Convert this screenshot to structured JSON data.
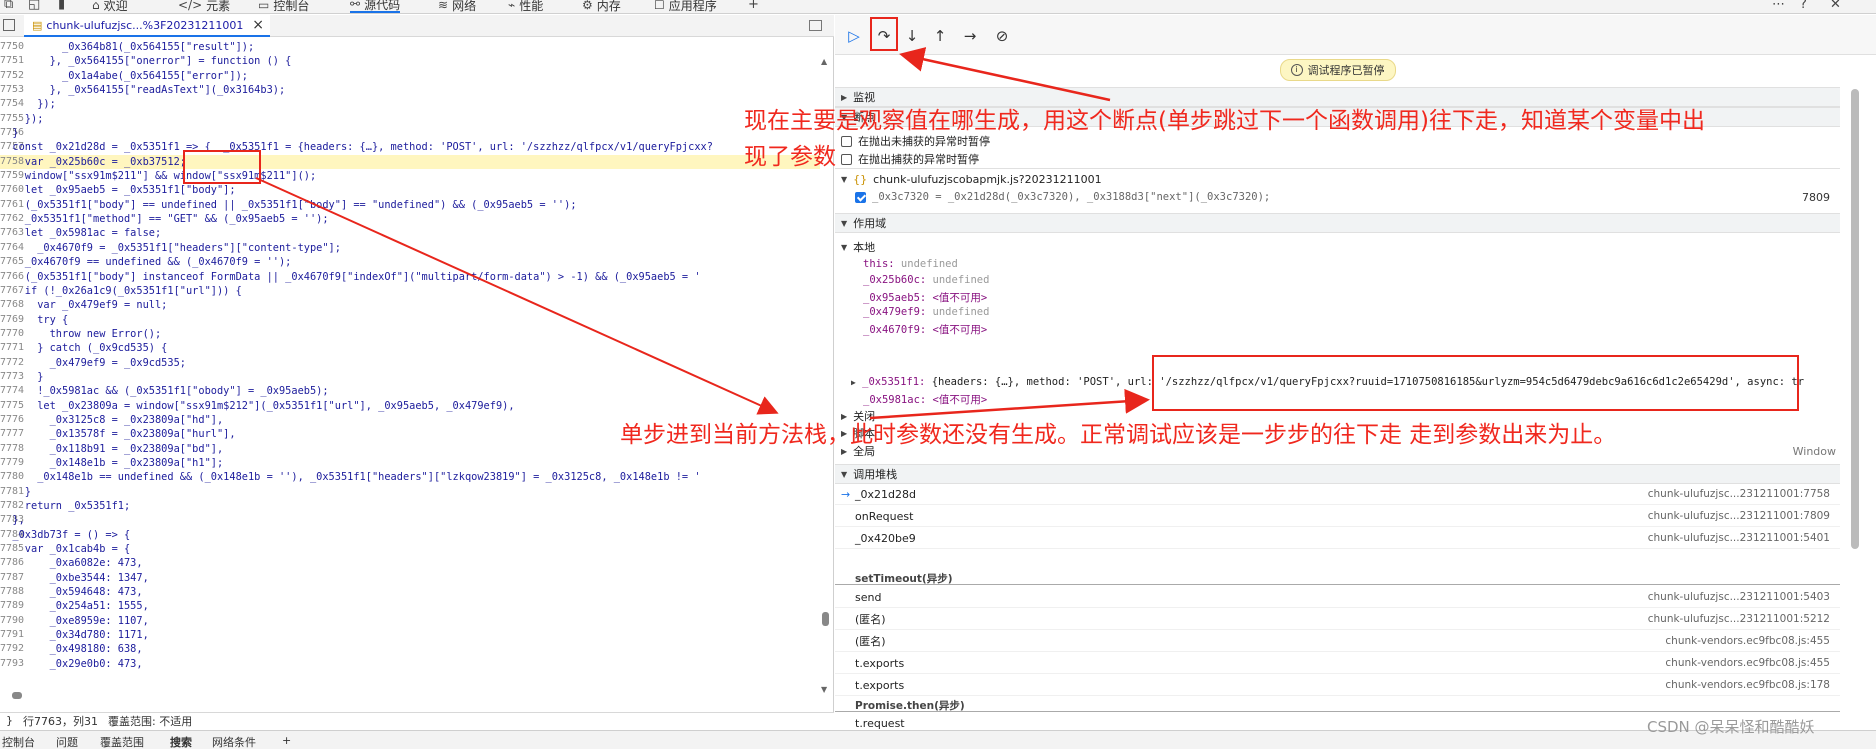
{
  "top_tabs": [
    {
      "label": "欢迎"
    },
    {
      "label": "元素"
    },
    {
      "label": "控制台"
    },
    {
      "label": "源代码"
    },
    {
      "label": "网络"
    },
    {
      "label": "性能"
    },
    {
      "label": "内存"
    },
    {
      "label": "应用程序"
    }
  ],
  "file_tab": {
    "label": "chunk-ulufuzjsc...%3F20231211001",
    "close": "×"
  },
  "code_lines": [
    {
      "n": "7750",
      "code": "          _0x364b81(_0x564155[\"result\"]);",
      "hl": false
    },
    {
      "n": "7751",
      "code": "        }, _0x564155[\"onerror\"] = function () {",
      "hl": false
    },
    {
      "n": "7752",
      "code": "          _0x1a4abe(_0x564155[\"error\"]);",
      "hl": false
    },
    {
      "n": "7753",
      "code": "        }, _0x564155[\"readAsText\"](_0x3164b3);",
      "hl": false
    },
    {
      "n": "7754",
      "code": "      });",
      "hl": false
    },
    {
      "n": "7755",
      "code": "    });",
      "hl": false
    },
    {
      "n": "7756",
      "code": "  }",
      "hl": false
    },
    {
      "n": "7757",
      "code": "  const _0x21d28d = _0x5351f1 => {  _0x5351f1 = {headers: {…}, method: 'POST', url: '/szzhzz/qlfpcx/v1/queryFpjcxx?",
      "hl": false
    },
    {
      "n": "7758",
      "code": "    var _0x25b60c = _0xb37512;",
      "hl": true
    },
    {
      "n": "7759",
      "code": "    window[\"ssx91m$211\"] && window[\"ssx91m$211\"]();",
      "hl": false
    },
    {
      "n": "7760",
      "code": "    let _0x95aeb5 = _0x5351f1[\"body\"];",
      "hl": false
    },
    {
      "n": "7761",
      "code": "    (_0x5351f1[\"body\"] == undefined || _0x5351f1[\"body\"] == \"undefined\") && (_0x95aeb5 = '');",
      "hl": false
    },
    {
      "n": "7762",
      "code": "    _0x5351f1[\"method\"] == \"GET\" && (_0x95aeb5 = '');",
      "hl": false
    },
    {
      "n": "7763",
      "code": "    let _0x5981ac = false;",
      "hl": false
    },
    {
      "n": "7764",
      "code": "      _0x4670f9 = _0x5351f1[\"headers\"][\"content-type\"];",
      "hl": false
    },
    {
      "n": "7765",
      "code": "    _0x4670f9 == undefined && (_0x4670f9 = '');",
      "hl": false
    },
    {
      "n": "7766",
      "code": "    (_0x5351f1[\"body\"] instanceof FormData || _0x4670f9[\"indexOf\"](\"multipart/form-data\") > -1) && (_0x95aeb5 = '",
      "hl": false
    },
    {
      "n": "7767",
      "code": "    if (!_0x26a1c9(_0x5351f1[\"url\"])) {",
      "hl": false
    },
    {
      "n": "7768",
      "code": "      var _0x479ef9 = null;",
      "hl": false
    },
    {
      "n": "7769",
      "code": "      try {",
      "hl": false
    },
    {
      "n": "7770",
      "code": "        throw new Error();",
      "hl": false
    },
    {
      "n": "7771",
      "code": "      } catch (_0x9cd535) {",
      "hl": false
    },
    {
      "n": "7772",
      "code": "        _0x479ef9 = _0x9cd535;",
      "hl": false
    },
    {
      "n": "7773",
      "code": "      }",
      "hl": false
    },
    {
      "n": "7774",
      "code": "      !_0x5981ac && (_0x5351f1[\"obody\"] = _0x95aeb5);",
      "hl": false
    },
    {
      "n": "7775",
      "code": "      let _0x23809a = window[\"ssx91m$212\"](_0x5351f1[\"url\"], _0x95aeb5, _0x479ef9),",
      "hl": false
    },
    {
      "n": "7776",
      "code": "        _0x3125c8 = _0x23809a[\"hd\"],",
      "hl": false
    },
    {
      "n": "7777",
      "code": "        _0x13578f = _0x23809a[\"hurl\"],",
      "hl": false
    },
    {
      "n": "7778",
      "code": "        _0x118b91 = _0x23809a[\"bd\"],",
      "hl": false
    },
    {
      "n": "7779",
      "code": "        _0x148e1b = _0x23809a[\"h1\"];",
      "hl": false
    },
    {
      "n": "7780",
      "code": "      _0x148e1b == undefined && (_0x148e1b = ''), _0x5351f1[\"headers\"][\"lzkqow23819\"] = _0x3125c8, _0x148e1b != '",
      "hl": false
    },
    {
      "n": "7781",
      "code": "    }",
      "hl": false
    },
    {
      "n": "7782",
      "code": "    return _0x5351f1;",
      "hl": false
    },
    {
      "n": "7783",
      "code": "  },",
      "hl": false
    },
    {
      "n": "7784",
      "code": "  _0x3db73f = () => {",
      "hl": false
    },
    {
      "n": "7785",
      "code": "    var _0x1cab4b = {",
      "hl": false
    },
    {
      "n": "7786",
      "code": "        _0xa6082e: 473,",
      "hl": false
    },
    {
      "n": "7787",
      "code": "        _0xbe3544: 1347,",
      "hl": false
    },
    {
      "n": "7788",
      "code": "        _0x594648: 473,",
      "hl": false
    },
    {
      "n": "7789",
      "code": "        _0x254a51: 1555,",
      "hl": false
    },
    {
      "n": "7790",
      "code": "        _0xe8959e: 1107,",
      "hl": false
    },
    {
      "n": "7791",
      "code": "        _0x34d780: 1171,",
      "hl": false
    },
    {
      "n": "7792",
      "code": "        _0x498180: 638,",
      "hl": false
    },
    {
      "n": "7793",
      "code": "        _0x29e0b0: 473,",
      "hl": false
    }
  ],
  "status": {
    "position": "行7763，列31",
    "coverage": "覆盖范围: 不适用"
  },
  "drawer_tabs": [
    "控制台",
    "问题",
    "覆盖范围",
    "搜索",
    "网络条件"
  ],
  "debugger": {
    "paused_label": "调试程序已暂停",
    "sections": {
      "monitor": "监视",
      "breakpoints": "断点",
      "scope": "作用域",
      "call_stack": "调用堆栈"
    },
    "pause_uncaught": "在抛出未捕获的异常时暂停",
    "pause_caught": "在抛出捕获的异常时暂停",
    "bp_file": "chunk-ulufuzjscobapmjk.js?20231211001",
    "bp_code": "_0x3c7320 = _0x21d28d(_0x3c7320), _0x3188d3[\"next\"](_0x3c7320);",
    "bp_line": "7809",
    "scope_local": "本地",
    "scope_vars": [
      {
        "name": "this:",
        "value": " undefined",
        "kind": "undef"
      },
      {
        "name": "_0x25b60c:",
        "value": " undefined",
        "kind": "undef"
      },
      {
        "name": "_0x95aeb5:",
        "value": " <值不可用>",
        "kind": "unavail"
      },
      {
        "name": "_0x479ef9:",
        "value": " undefined",
        "kind": "undef"
      },
      {
        "name": "_0x4670f9:",
        "value": " <值不可用>",
        "kind": "unavail"
      }
    ],
    "scope_obj": {
      "name": "_0x5351f1:",
      "value": " {headers: {…}, method: 'POST', url: '/szzhzz/qlfpcx/v1/queryFpjcxx?ruuid=1710750816185&urlyzm=954c5d6479debc9a616c6d1c2e65429d', async: tr"
    },
    "scope_last": {
      "name": "_0x5981ac:",
      "value": " <值不可用>"
    },
    "scope_closure": "关闭",
    "scope_script": "脚本",
    "scope_global": "全局",
    "scope_global_val": "Window",
    "stack": [
      {
        "fn": "_0x21d28d",
        "loc": "chunk-ulufuzjsc...231211001:7758",
        "current": true
      },
      {
        "fn": "onRequest",
        "loc": "chunk-ulufuzjsc...231211001:7809",
        "current": false
      },
      {
        "fn": "_0x420be9",
        "loc": "chunk-ulufuzjsc...231211001:5401",
        "current": false
      }
    ],
    "async1": "setTimeout(异步)",
    "stack2": [
      {
        "fn": "send",
        "loc": "chunk-ulufuzjsc...231211001:5403"
      },
      {
        "fn": "(匿名)",
        "loc": "chunk-ulufuzjsc...231211001:5212"
      },
      {
        "fn": "(匿名)",
        "loc": "chunk-vendors.ec9fbc08.js:455"
      },
      {
        "fn": "t.exports",
        "loc": "chunk-vendors.ec9fbc08.js:455"
      },
      {
        "fn": "t.exports",
        "loc": "chunk-vendors.ec9fbc08.js:178"
      }
    ],
    "async2": "Promise.then(异步)",
    "stack3_fn": "t.request"
  },
  "annotations": {
    "top_line1": "现在主要是观察值在哪生成，用这个断点(单步跳过下一个函数调用)往下走，知道某个变量中出",
    "top_line2": "现了参数",
    "middle": "单步进到当前方法栈，此时参数还没有生成。正常调试应该是一步步的往下走 走到参数出来为止。",
    "color": "#e8261c"
  },
  "watermark": "CSDN @呆呆怪和酷酷妖"
}
